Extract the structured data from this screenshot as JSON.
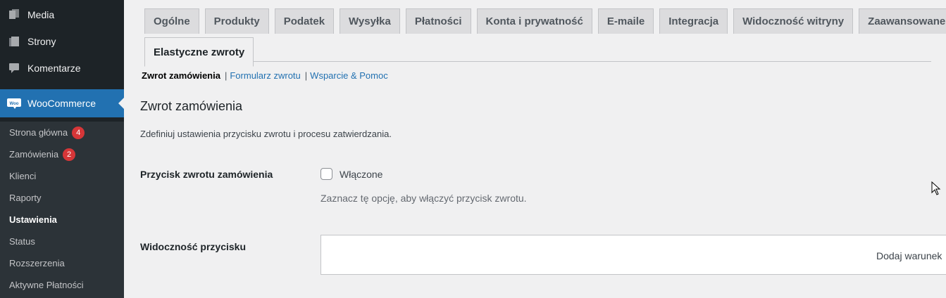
{
  "sidebar": {
    "items": [
      {
        "label": "Media",
        "icon": "media-icon"
      },
      {
        "label": "Strony",
        "icon": "pages-icon"
      },
      {
        "label": "Komentarze",
        "icon": "comments-icon"
      }
    ],
    "woocommerce": {
      "label": "WooCommerce",
      "icon": "woocommerce-icon",
      "accent": "#2271b1"
    },
    "submenu": [
      {
        "label": "Strona główna",
        "badge": "4"
      },
      {
        "label": "Zamówienia",
        "badge": "2"
      },
      {
        "label": "Klienci"
      },
      {
        "label": "Raporty"
      },
      {
        "label": "Ustawienia",
        "active": true
      },
      {
        "label": "Status"
      },
      {
        "label": "Rozszerzenia"
      },
      {
        "label": "Aktywne Płatności"
      }
    ]
  },
  "tabs": {
    "row1": [
      "Ogólne",
      "Produkty",
      "Podatek",
      "Wysyłka",
      "Płatności",
      "Konta i prywatność",
      "E-maile",
      "Integracja",
      "Widoczność witryny",
      "Zaawansowane"
    ],
    "row2": [
      "Elastyczne zwroty"
    ],
    "active": "Elastyczne zwroty"
  },
  "subnav": {
    "current": "Zwrot zamówienia",
    "links": [
      "Formularz zwrotu",
      "Wsparcie & Pomoc"
    ]
  },
  "section": {
    "title": "Zwrot zamówienia",
    "description": "Zdefiniuj ustawienia przycisku zwrotu i procesu zatwierdzania."
  },
  "refund_button": {
    "label": "Przycisk zwrotu zamówienia",
    "checkbox_label": "Włączone",
    "checked": false,
    "help": "Zaznacz tę opcję, aby włączyć przycisk zwrotu."
  },
  "visibility": {
    "label": "Widoczność przycisku",
    "add_condition": "Dodaj warunek"
  }
}
